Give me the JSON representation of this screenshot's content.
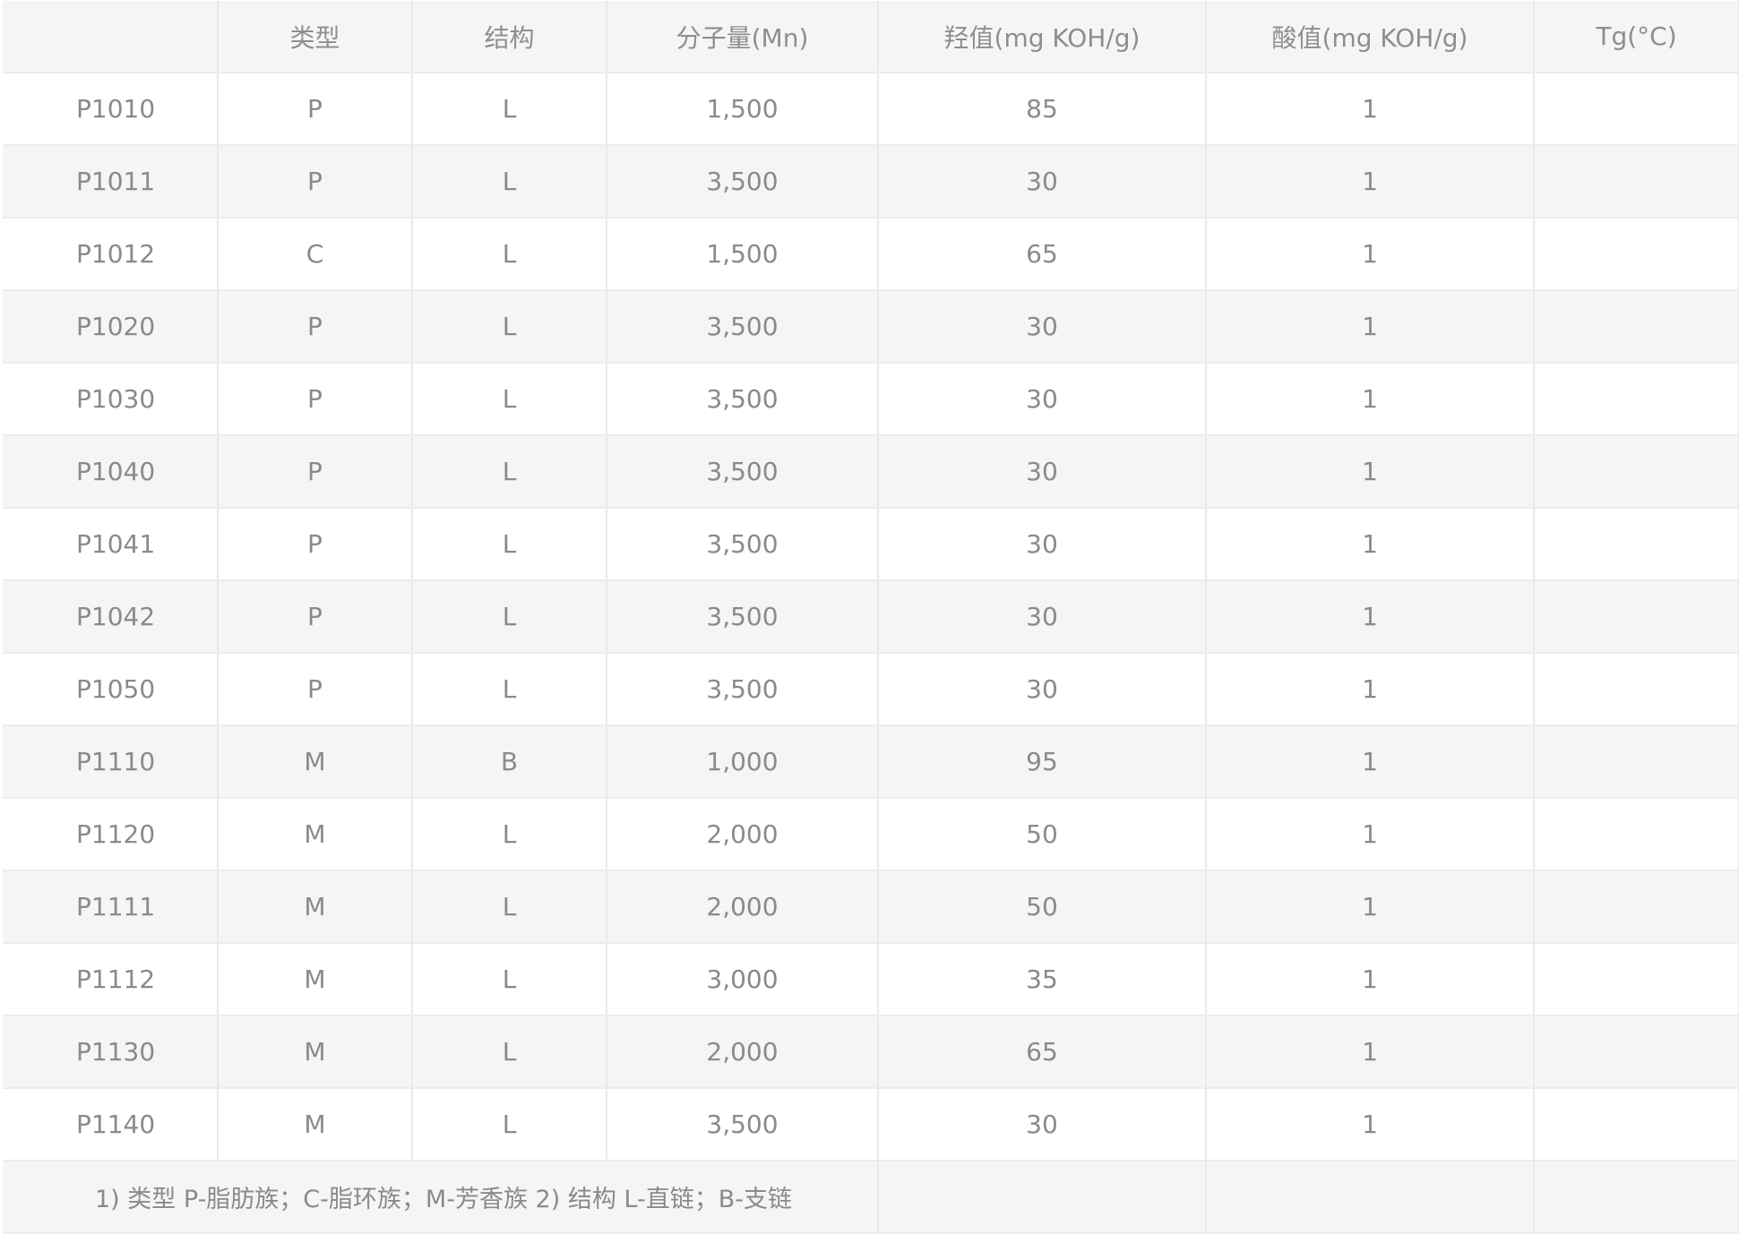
{
  "table": {
    "headers": [
      "",
      "类型",
      "结构",
      "分子量(Mn)",
      "羟值(mg KOH/g)",
      "酸值(mg KOH/g)",
      "Tg(°C)"
    ],
    "rows": [
      [
        "P1010",
        "P",
        "L",
        "1,500",
        "85",
        "1",
        ""
      ],
      [
        "P1011",
        "P",
        "L",
        "3,500",
        "30",
        "1",
        ""
      ],
      [
        "P1012",
        "C",
        "L",
        "1,500",
        "65",
        "1",
        ""
      ],
      [
        "P1020",
        "P",
        "L",
        "3,500",
        "30",
        "1",
        ""
      ],
      [
        "P1030",
        "P",
        "L",
        "3,500",
        "30",
        "1",
        ""
      ],
      [
        "P1040",
        "P",
        "L",
        "3,500",
        "30",
        "1",
        ""
      ],
      [
        "P1041",
        "P",
        "L",
        "3,500",
        "30",
        "1",
        ""
      ],
      [
        "P1042",
        "P",
        "L",
        "3,500",
        "30",
        "1",
        ""
      ],
      [
        "P1050",
        "P",
        "L",
        "3,500",
        "30",
        "1",
        ""
      ],
      [
        "P1110",
        "M",
        "B",
        "1,000",
        "95",
        "1",
        ""
      ],
      [
        "P1120",
        "M",
        "L",
        "2,000",
        "50",
        "1",
        ""
      ],
      [
        "P1111",
        "M",
        "L",
        "2,000",
        "50",
        "1",
        ""
      ],
      [
        "P1112",
        "M",
        "L",
        "3,000",
        "35",
        "1",
        ""
      ],
      [
        "P1130",
        "M",
        "L",
        "2,000",
        "65",
        "1",
        ""
      ],
      [
        "P1140",
        "M",
        "L",
        "3,500",
        "30",
        "1",
        ""
      ]
    ],
    "footnote": "1) 类型 P-脂肪族；C-脂环族；M-芳香族 2) 结构 L-直链；B-支链"
  }
}
